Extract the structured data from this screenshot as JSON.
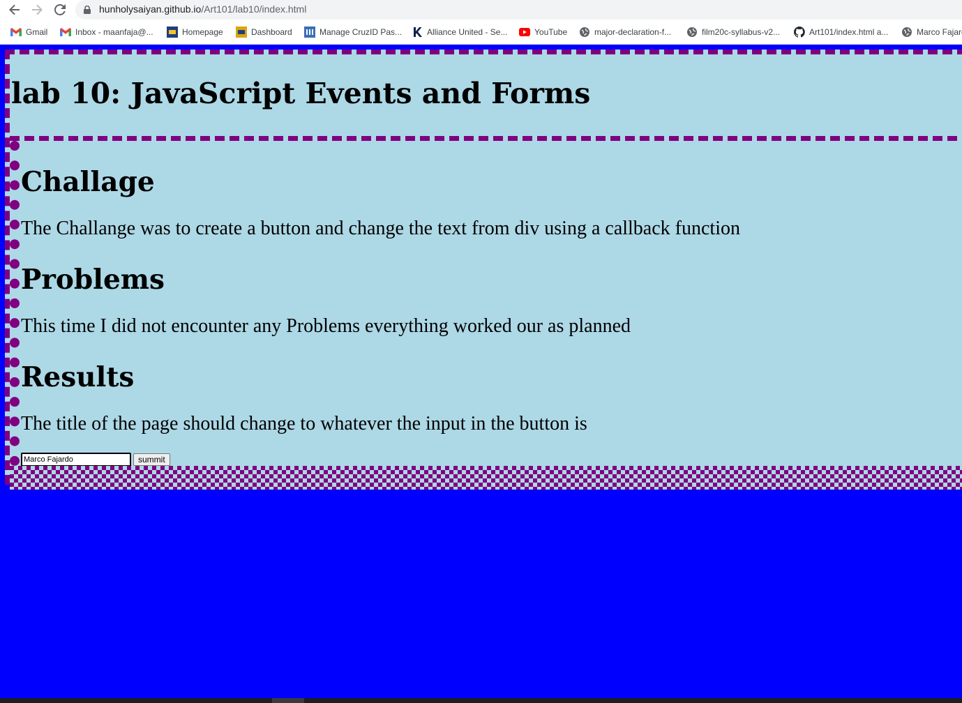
{
  "browser": {
    "url_host": "hunholysaiyan.github.io",
    "url_path": "/Art101/lab10/index.html",
    "bookmarks": [
      {
        "label": "Gmail",
        "icon": "gmail-icon"
      },
      {
        "label": "Inbox - maanfaja@...",
        "icon": "gmail-icon"
      },
      {
        "label": "Homepage",
        "icon": "ucsc-icon"
      },
      {
        "label": "Dashboard",
        "icon": "ucsc-dashboard-icon"
      },
      {
        "label": "Manage CruzID Pas...",
        "icon": "its-icon"
      },
      {
        "label": "Alliance United - Se...",
        "icon": "alliance-k-icon"
      },
      {
        "label": "YouTube",
        "icon": "youtube-icon"
      },
      {
        "label": "major-declaration-f...",
        "icon": "globe-icon"
      },
      {
        "label": "film20c-syllabus-v2...",
        "icon": "globe-icon"
      },
      {
        "label": "Art101/index.html a...",
        "icon": "github-icon"
      },
      {
        "label": "Marco Fajardo",
        "icon": "globe-icon"
      }
    ]
  },
  "page": {
    "title": "lab 10: JavaScript Events and Forms",
    "sections": [
      {
        "heading": "Challage",
        "text": "The Challange was to create a button and change the text from div using a callback function"
      },
      {
        "heading": "Problems",
        "text": "This time I did not encounter any Problems everything worked our as planned"
      },
      {
        "heading": "Results",
        "text": "The title of the page should change to whatever the input in the button is"
      }
    ],
    "form": {
      "input_value": "Marco Fajardo",
      "button_label": "summit"
    }
  },
  "colors": {
    "page_background": "#0000ff",
    "container_background": "#add8e6",
    "border": "#800080"
  }
}
